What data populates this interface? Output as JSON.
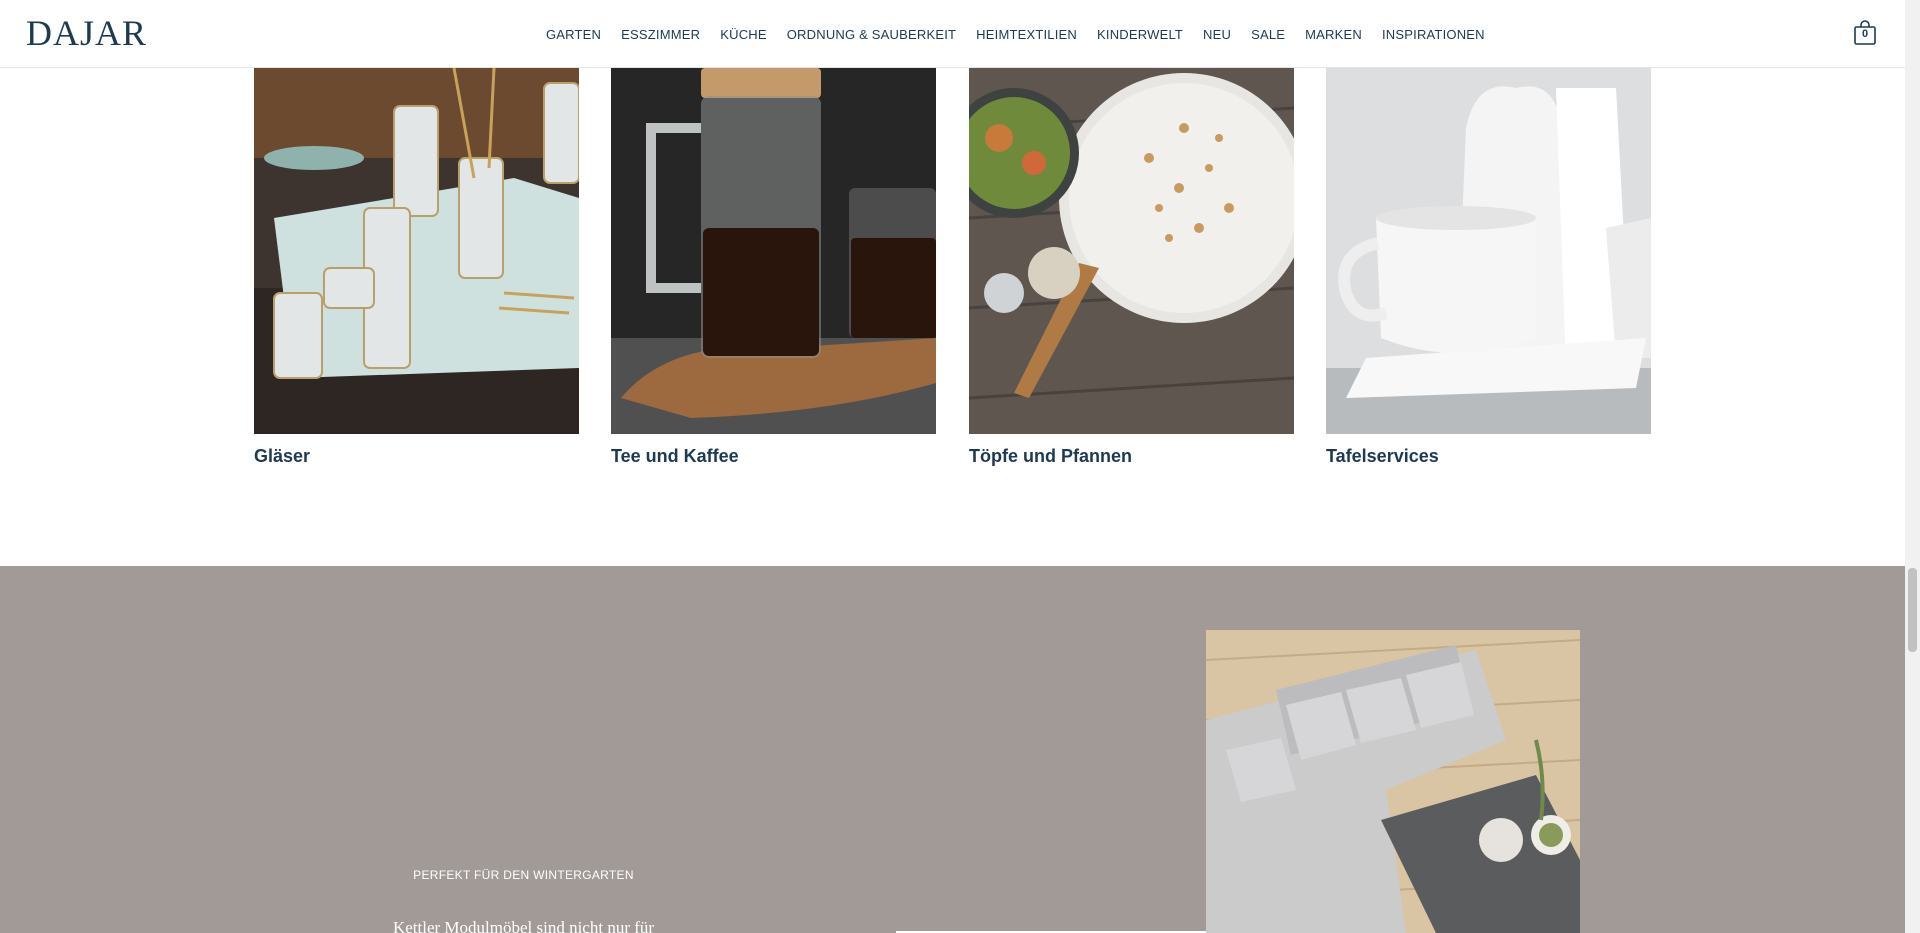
{
  "header": {
    "logo": "DAJAR",
    "nav": [
      "GARTEN",
      "ESSZIMMER",
      "KÜCHE",
      "ORDNUNG & SAUBERKEIT",
      "HEIMTEXTILIEN",
      "KINDERWELT",
      "NEU",
      "SALE",
      "MARKEN",
      "INSPIRATIONEN"
    ],
    "cart_count": "0"
  },
  "categories": [
    {
      "title": "Gläser"
    },
    {
      "title": "Tee und Kaffee"
    },
    {
      "title": "Töpfe und Pfannen"
    },
    {
      "title": "Tafelservices"
    }
  ],
  "promo": {
    "kicker": "PERFEKT FÜR DEN WINTERGARTEN",
    "body": "Kettler Modulmöbel sind nicht nur für"
  },
  "colors": {
    "brand_text": "#1c3a52",
    "promo_background": "#a29a97"
  }
}
